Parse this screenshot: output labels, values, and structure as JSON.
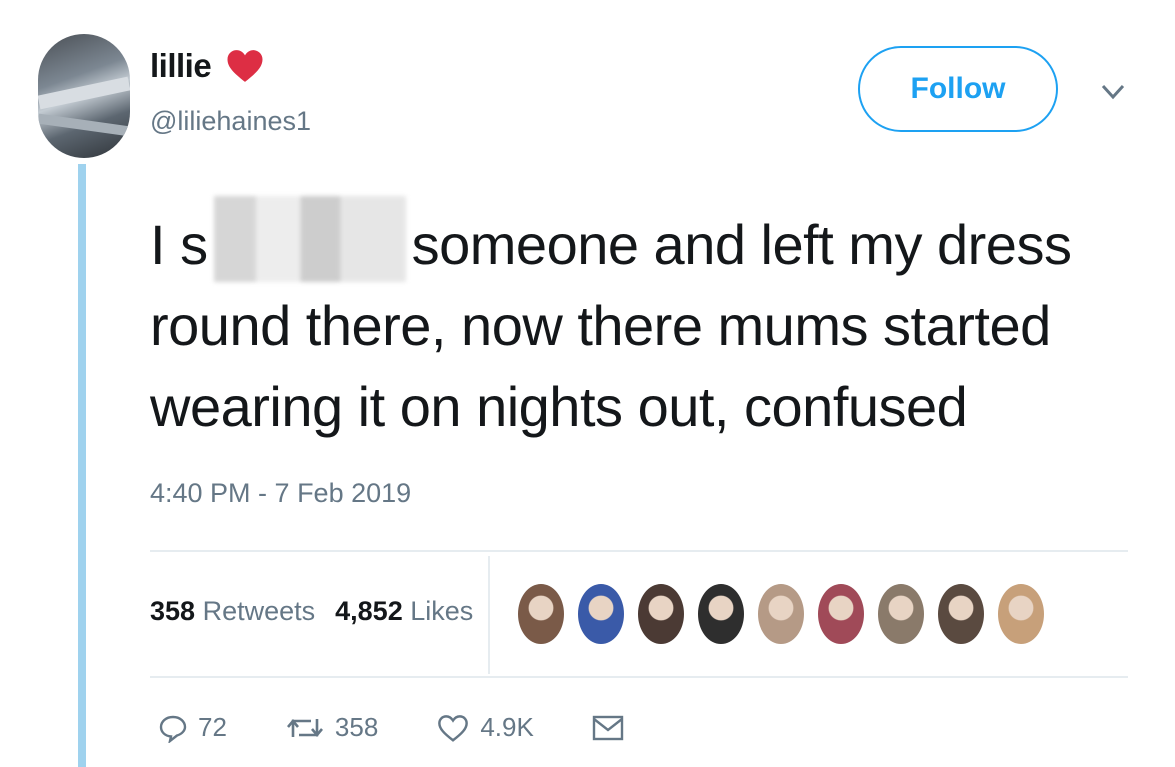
{
  "user": {
    "name": "lillie",
    "handle": "@liliehaines1",
    "follow_label": "Follow"
  },
  "tweet": {
    "text_start": "I s",
    "text_rest": "someone and left my dress round there, now there mums started wearing it on nights out, confused",
    "timestamp": "4:40 PM - 7 Feb 2019"
  },
  "stats": {
    "retweets_count": "358",
    "retweets_label": "Retweets",
    "likes_count": "4,852",
    "likes_label": "Likes"
  },
  "actions": {
    "reply_count": "72",
    "retweet_count": "358",
    "like_count": "4.9K"
  },
  "colors": {
    "accent": "#1da1f2",
    "heart": "#e0245e",
    "muted": "#657786",
    "thread_line": "#9fd2ee"
  },
  "likers": [
    "#7a5a48",
    "#3a5aa8",
    "#4b3a34",
    "#2e2e2e",
    "#b59a86",
    "#a04a58",
    "#8a7a6a",
    "#5a4a40",
    "#c7a07a"
  ]
}
